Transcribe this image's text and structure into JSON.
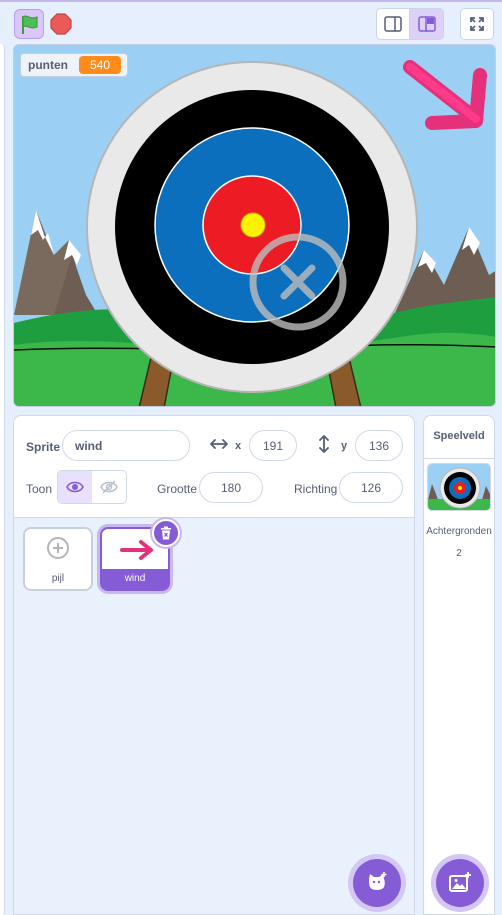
{
  "toolbar": {
    "green_flag_icon": "green-flag-icon",
    "stop_icon": "stop-icon",
    "small_stage_icon": "small-stage-icon",
    "normal_stage_icon": "normal-stage-icon",
    "fullscreen_icon": "fullscreen-icon"
  },
  "stage": {
    "monitor": {
      "label": "punten",
      "value": "540"
    }
  },
  "sprite_info": {
    "sprite_label": "Sprite",
    "sprite_name": "wind",
    "x_label": "x",
    "x_value": "191",
    "y_label": "y",
    "y_value": "136",
    "show_label": "Toon",
    "size_label": "Grootte",
    "size_value": "180",
    "direction_label": "Richting",
    "direction_value": "126"
  },
  "sprites": [
    {
      "name": "pijl",
      "selected": false
    },
    {
      "name": "wind",
      "selected": true
    }
  ],
  "stage_pane": {
    "title": "Speelveld",
    "backdrops_label": "Achtergronden",
    "backdrops_count": "2"
  },
  "colors": {
    "accent": "#855cd6",
    "monitor_value": "#ff8c1a",
    "stop": "#ec5959",
    "flag": "#4cbf56"
  }
}
